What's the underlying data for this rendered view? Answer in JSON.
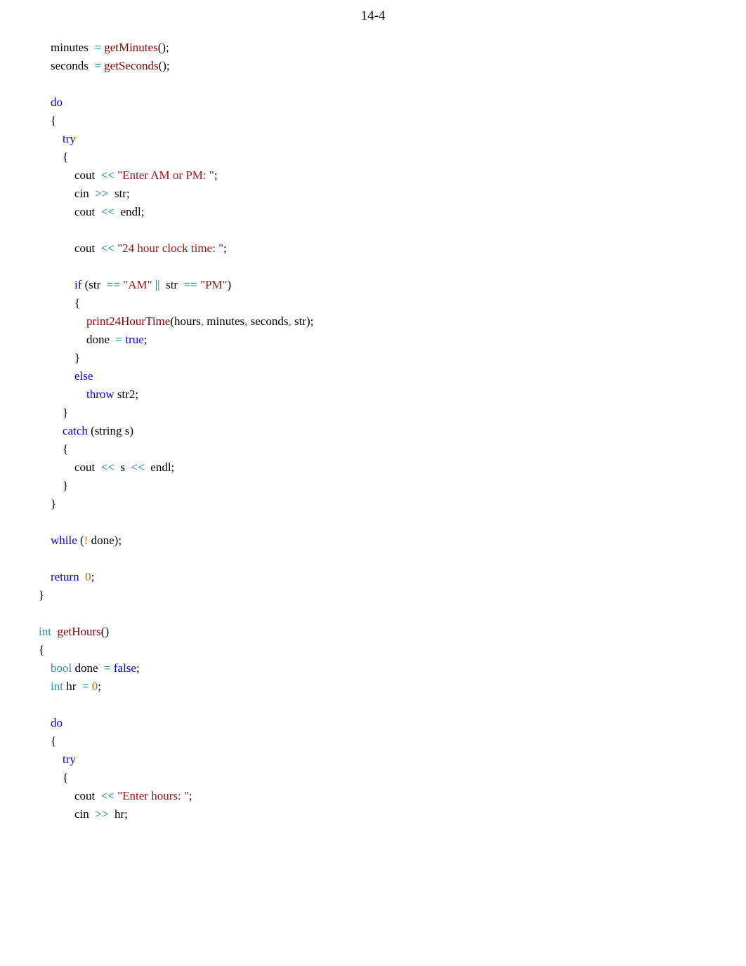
{
  "header": {
    "page_number": "14-4"
  },
  "code": {
    "l1a": "    minutes ",
    "l1b": " = ",
    "l1c": "getMinutes",
    "l1d": "();",
    "l2a": "    seconds ",
    "l2b": " = ",
    "l2c": "getSeconds",
    "l2d": "();",
    "l3": " ",
    "l4": "    do",
    "l5": "    {",
    "l6": "        try",
    "l7": "        {",
    "l8a": "            cout ",
    "l8b": " << ",
    "l8c": "\"Enter AM or PM: \"",
    "l8d": ";",
    "l9a": "            cin ",
    "l9b": " >> ",
    "l9c": " str;",
    "l10a": "            cout ",
    "l10b": " << ",
    "l10c": " endl;",
    "l11": " ",
    "l12a": "            cout ",
    "l12b": " << ",
    "l12c": "\"24 hour clock time: \"",
    "l12d": ";",
    "l13": " ",
    "l14a": "            if",
    "l14b": " (str ",
    "l14c": " == ",
    "l14d": "\"AM\"",
    "l14e": " || ",
    "l14f": " str ",
    "l14g": " == ",
    "l14h": "\"PM\"",
    "l14i": ")",
    "l15": "            {",
    "l16a": "                ",
    "l16b": "print24HourTime",
    "l16c": "(hours",
    "l16d": ", ",
    "l16e": "minutes",
    "l16f": ", ",
    "l16g": "seconds",
    "l16h": ", ",
    "l16i": "str);",
    "l17a": "                done ",
    "l17b": " = ",
    "l17c": "true",
    "l17d": ";",
    "l18": "            }",
    "l19": "            else",
    "l20a": "                ",
    "l20b": "throw",
    "l20c": " str2;",
    "l21": "        }",
    "l22a": "        ",
    "l22b": "catch",
    "l22c": " (string s)",
    "l23": "        {",
    "l24a": "            cout ",
    "l24b": " << ",
    "l24c": " s ",
    "l24d": " << ",
    "l24e": " endl;",
    "l25": "        }",
    "l26": "    }",
    "l27": " ",
    "l28a": "    ",
    "l28b": "while",
    "l28c": " (",
    "l28d": "!",
    "l28e": " done);",
    "l29": " ",
    "l30a": "    ",
    "l30b": "return",
    "l30c": "0",
    "l30d": ";",
    "l31": "}",
    "l32": " ",
    "l33a": "int",
    "l33b": "getHours",
    "l33c": "()",
    "l34": "{",
    "l35a": "    ",
    "l35b": "bool",
    "l35c": " done ",
    "l35d": " = ",
    "l35e": "false",
    "l35f": ";",
    "l36a": "    ",
    "l36b": "int",
    "l36c": " hr ",
    "l36d": " = ",
    "l36e": "0",
    "l36f": ";",
    "l37": " ",
    "l38": "    do",
    "l39": "    {",
    "l40": "        try",
    "l41": "        {",
    "l42a": "            cout ",
    "l42b": " << ",
    "l42c": "\"Enter hours: \"",
    "l42d": ";",
    "l43a": "            cin ",
    "l43b": " >> ",
    "l43c": " hr;"
  }
}
